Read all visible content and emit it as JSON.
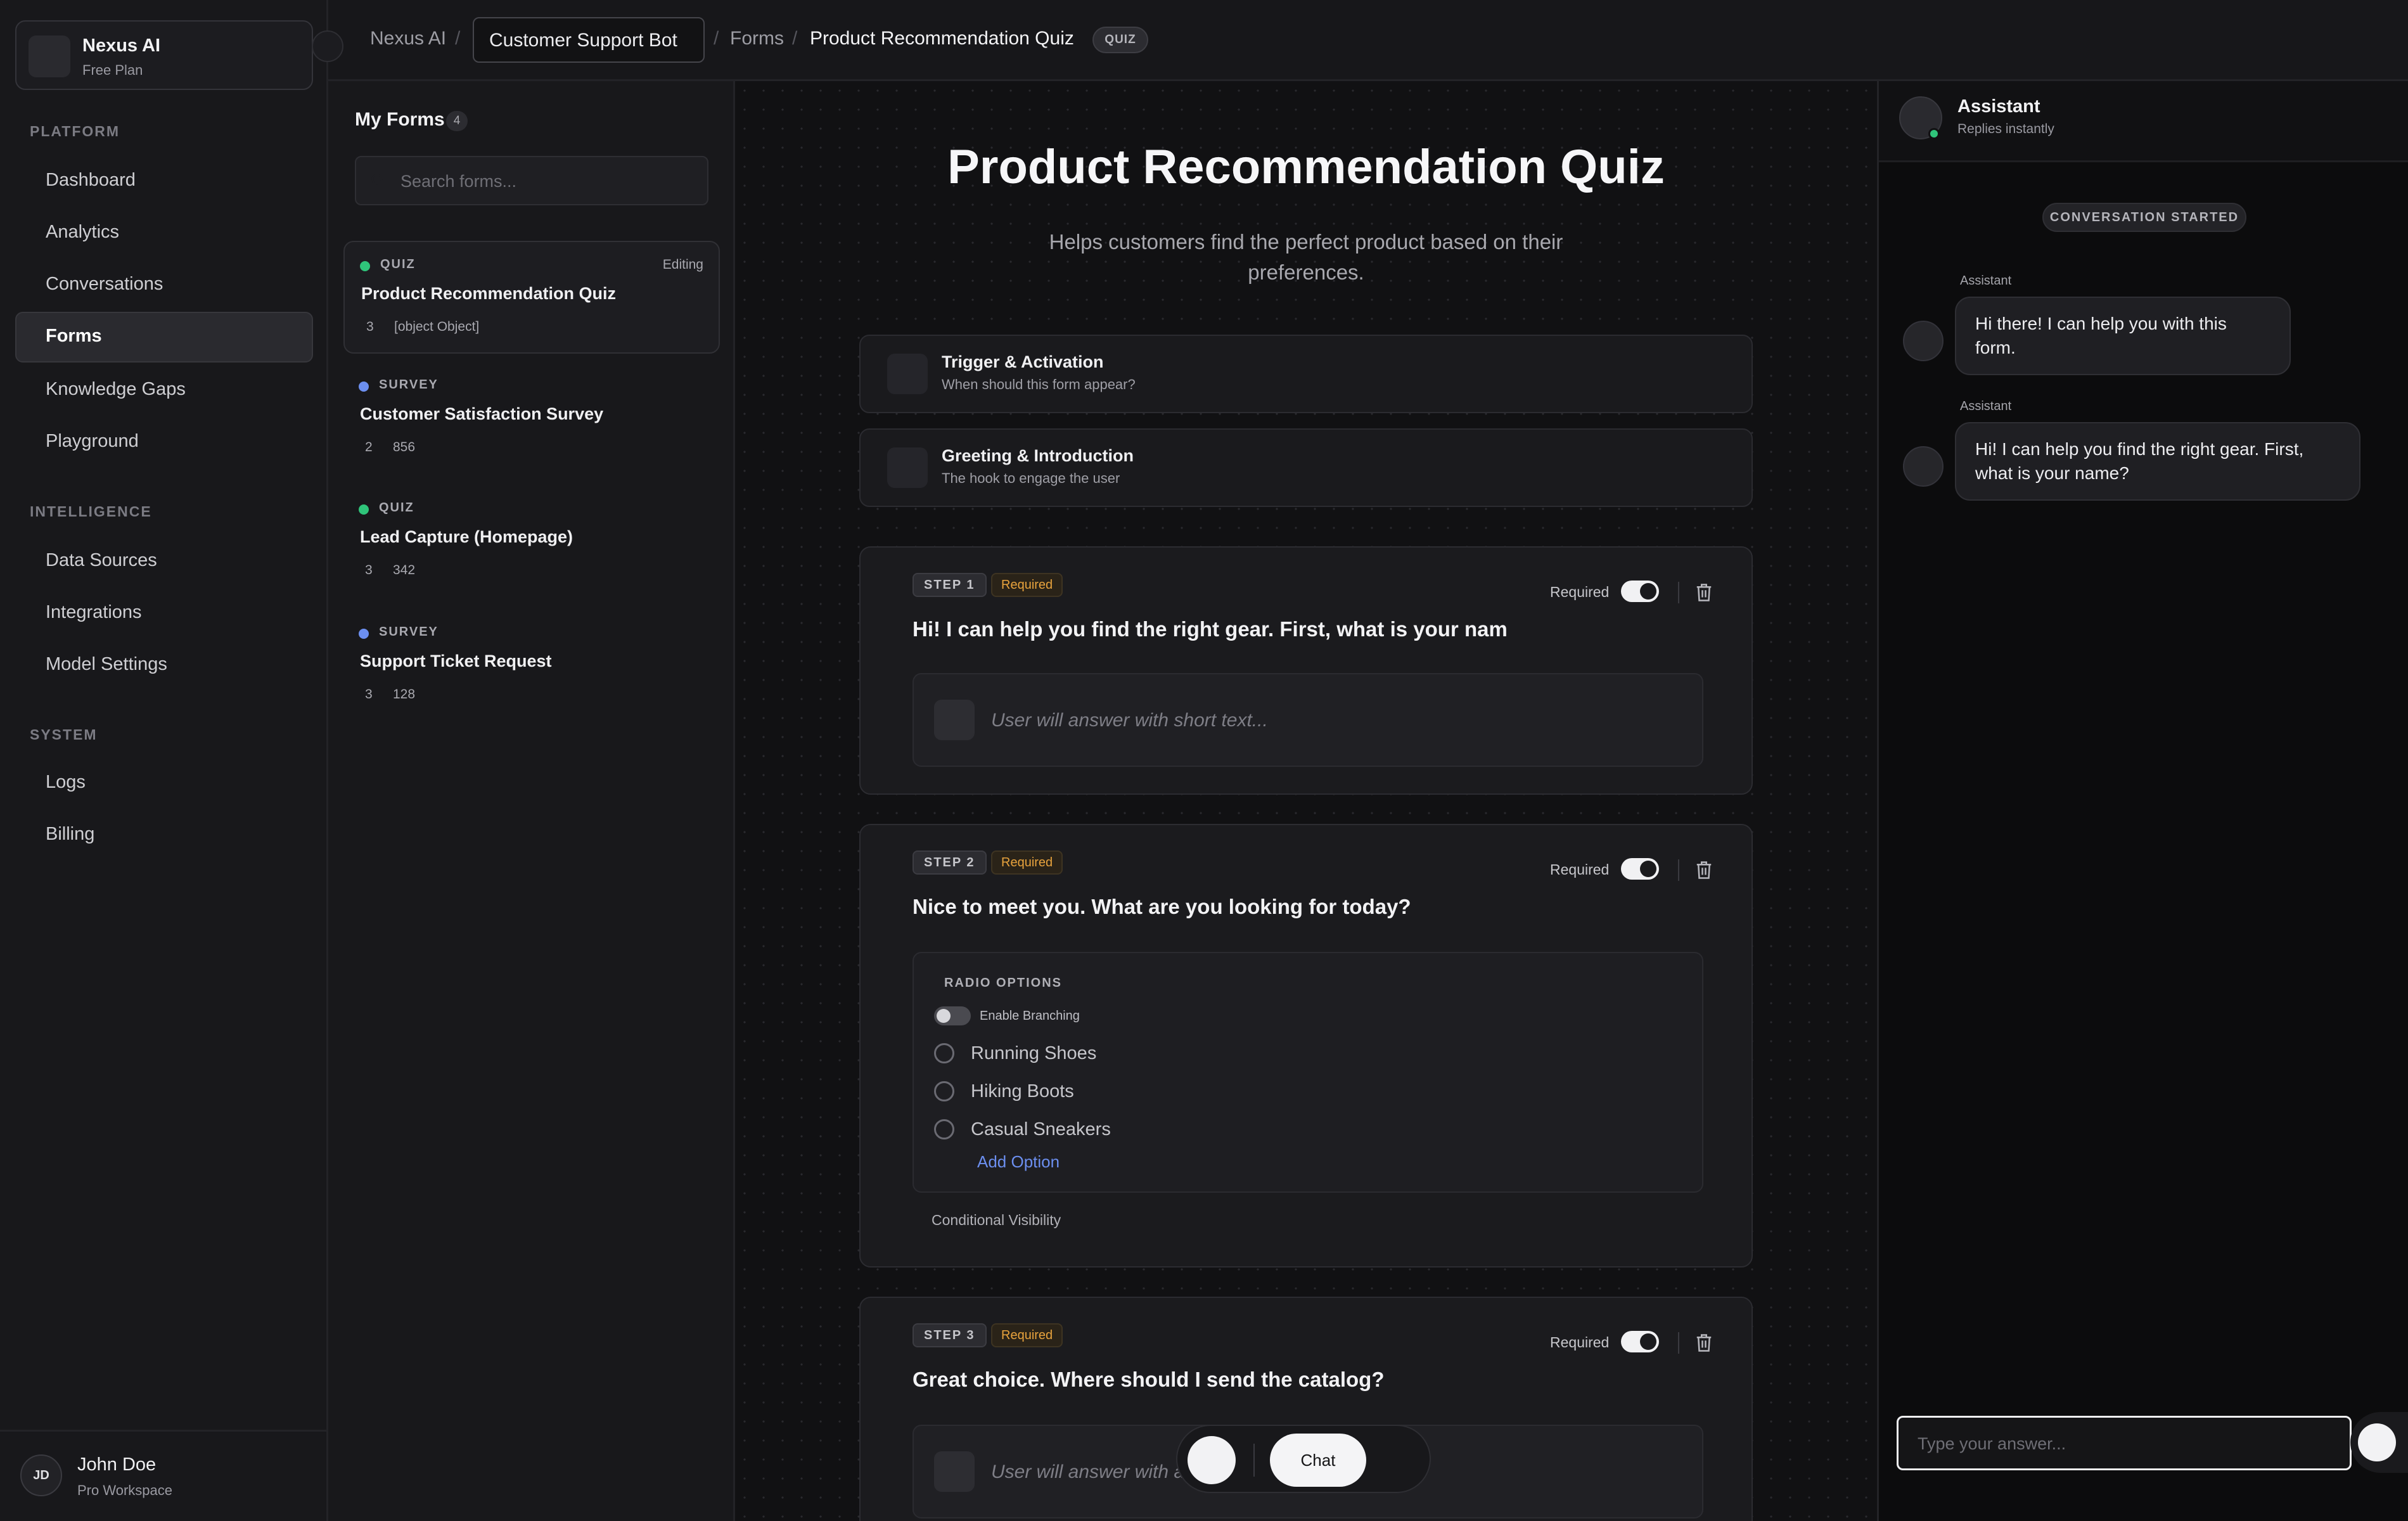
{
  "workspace": {
    "name": "Nexus AI",
    "plan": "Free Plan"
  },
  "sidebar": {
    "sections": [
      {
        "title": "PLATFORM",
        "items": [
          "Dashboard",
          "Analytics",
          "Conversations",
          "Forms",
          "Knowledge Gaps",
          "Playground"
        ]
      },
      {
        "title": "INTELLIGENCE",
        "items": [
          "Data Sources",
          "Integrations",
          "Model Settings"
        ]
      },
      {
        "title": "SYSTEM",
        "items": [
          "Logs",
          "Billing"
        ]
      }
    ],
    "active_item": "Forms",
    "user": {
      "initials": "JD",
      "name": "John Doe",
      "workspace": "Pro Workspace"
    }
  },
  "breadcrumb": {
    "root": "Nexus AI",
    "bot": "Customer Support Bot",
    "section": "Forms",
    "current": "Product Recommendation Quiz",
    "badge": "QUIZ",
    "separator": "/"
  },
  "forms_panel": {
    "title": "My Forms",
    "count": "4",
    "search_placeholder": "Search forms...",
    "items": [
      {
        "type": "QUIZ",
        "name": "Product Recommendation Quiz",
        "questions": "3",
        "responses": "[object Object]",
        "status": "Editing",
        "dot_color": "#2fc47a"
      },
      {
        "type": "SURVEY",
        "name": "Customer Satisfaction Survey",
        "questions": "2",
        "responses": "856",
        "status": "",
        "dot_color": "#6c8ff0"
      },
      {
        "type": "QUIZ",
        "name": "Lead Capture (Homepage)",
        "questions": "3",
        "responses": "342",
        "status": "",
        "dot_color": "#2fc47a"
      },
      {
        "type": "SURVEY",
        "name": "Support Ticket Request",
        "questions": "3",
        "responses": "128",
        "status": "",
        "dot_color": "#6c8ff0"
      }
    ]
  },
  "editor": {
    "title": "Product Recommendation Quiz",
    "description": "Helps customers find the perfect product based on their preferences.",
    "sections": [
      {
        "title": "Trigger & Activation",
        "subtitle": "When should this form appear?"
      },
      {
        "title": "Greeting & Introduction",
        "subtitle": "The hook to engage the user"
      }
    ],
    "required_label": "Required",
    "steps": [
      {
        "badge": "STEP 1",
        "required_badge": "Required",
        "question": "Hi! I can help you find the right gear. First, what is your nam",
        "answer_placeholder": "User will answer with short text..."
      },
      {
        "badge": "STEP 2",
        "required_badge": "Required",
        "question": "Nice to meet you. What are you looking for today?",
        "options_label": "RADIO OPTIONS",
        "branching_label": "Enable Branching",
        "options": [
          "Running Shoes",
          "Hiking Boots",
          "Casual Sneakers"
        ],
        "add_option": "Add Option",
        "conditional": "Conditional Visibility"
      },
      {
        "badge": "STEP 3",
        "required_badge": "Required",
        "question": "Great choice. Where should I send the catalog?",
        "answer_placeholder": "User will answer with a"
      }
    ],
    "float_bar": {
      "chat_label": "Chat"
    }
  },
  "chat": {
    "assistant_name": "Assistant",
    "assistant_status": "Replies instantly",
    "started_label": "CONVERSATION STARTED",
    "messages": [
      {
        "author": "Assistant",
        "text": "Hi there! I can help you with this form."
      },
      {
        "author": "Assistant",
        "text": "Hi! I can help you find the right gear. First, what is your name?"
      }
    ],
    "input_placeholder": "Type your answer..."
  },
  "colors": {
    "accent_link": "#6c8ff0",
    "required": "#e8a33d",
    "online": "#2fc47a"
  }
}
